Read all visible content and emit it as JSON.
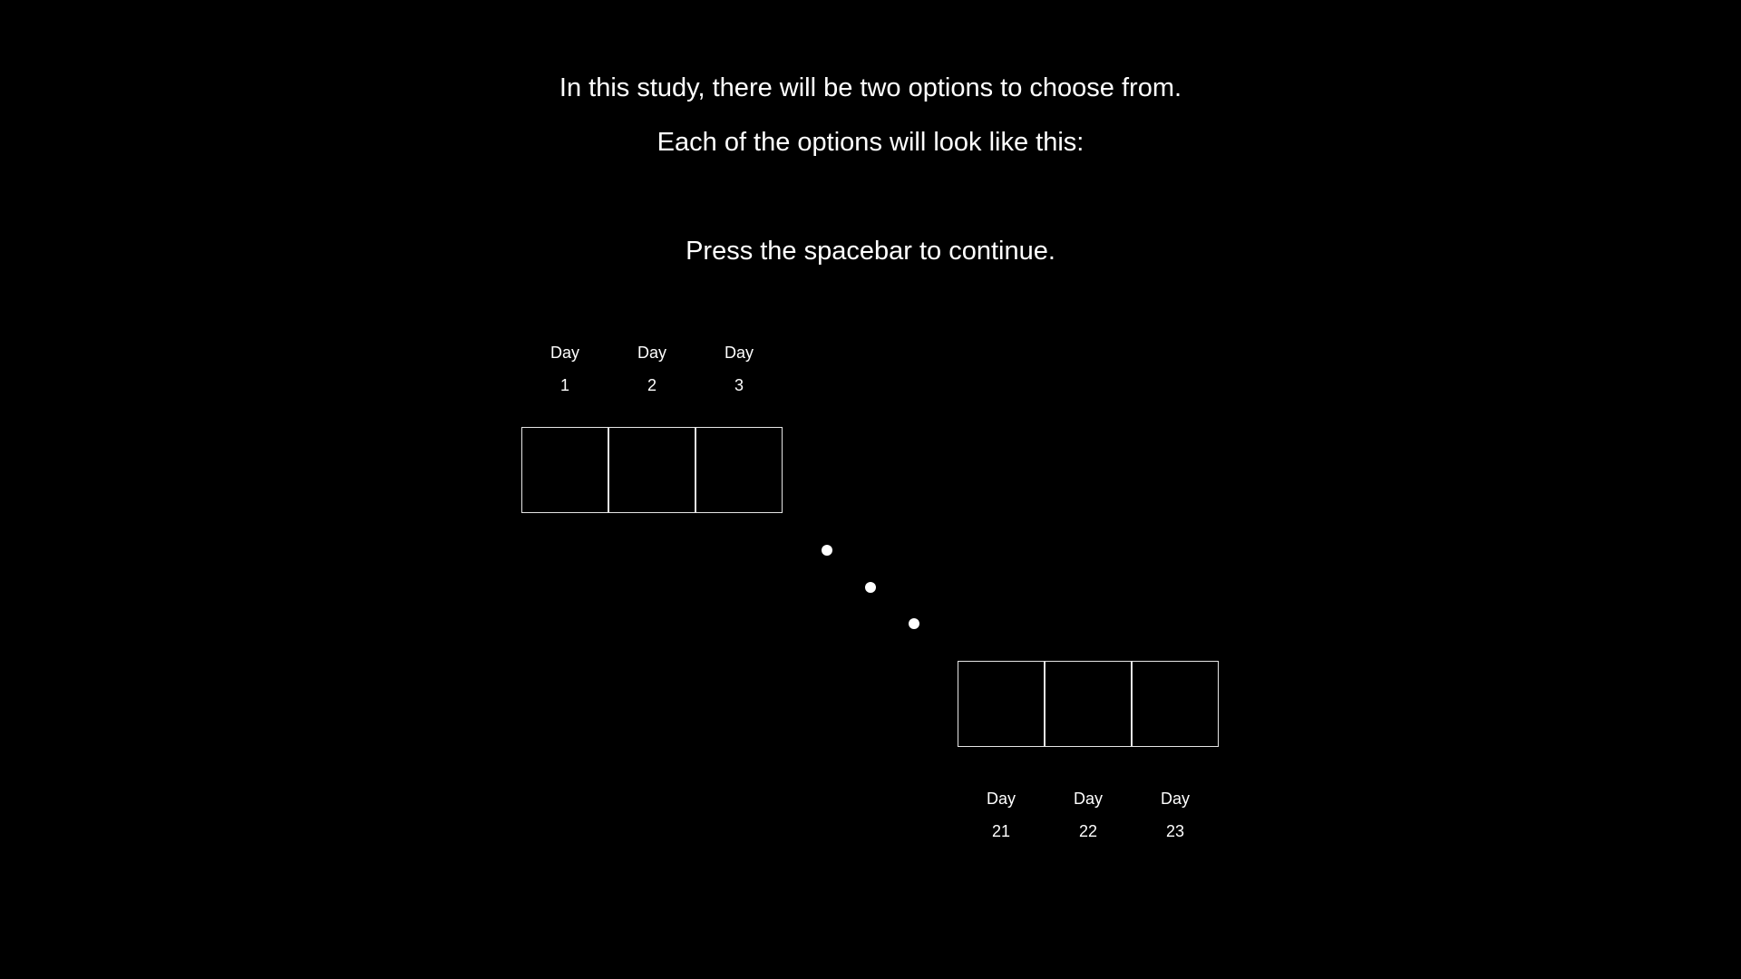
{
  "instructions": {
    "line1": "In this study, there will be two options to choose from.",
    "line2": "Each of the options will look like this:",
    "continue": "Press the spacebar to continue."
  },
  "option_top": {
    "days": [
      {
        "word": "Day",
        "number": "1"
      },
      {
        "word": "Day",
        "number": "2"
      },
      {
        "word": "Day",
        "number": "3"
      }
    ]
  },
  "option_bottom": {
    "days": [
      {
        "word": "Day",
        "number": "21"
      },
      {
        "word": "Day",
        "number": "22"
      },
      {
        "word": "Day",
        "number": "23"
      }
    ]
  },
  "colors": {
    "background": "#000000",
    "foreground": "#ffffff",
    "cell_border": "#e6e6e6"
  }
}
